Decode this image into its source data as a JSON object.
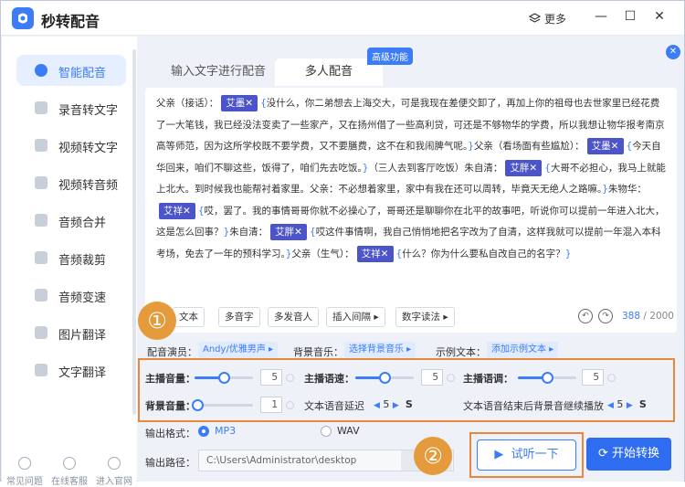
{
  "app": {
    "title": "秒转配音",
    "more_label": "更多"
  },
  "sidebar": {
    "items": [
      {
        "label": "智能配音",
        "active": true
      },
      {
        "label": "录音转文字"
      },
      {
        "label": "视频转文字"
      },
      {
        "label": "视频转音频"
      },
      {
        "label": "音频合并"
      },
      {
        "label": "音频裁剪"
      },
      {
        "label": "音频变速"
      },
      {
        "label": "图片翻译"
      },
      {
        "label": "文字翻译"
      }
    ],
    "bottom": [
      {
        "label": "常见问题"
      },
      {
        "label": "在线客服"
      },
      {
        "label": "进入官网"
      }
    ]
  },
  "tabs": [
    {
      "label": "输入文字进行配音"
    },
    {
      "label": "多人配音",
      "active": true
    }
  ],
  "badge": "高级功能",
  "editor": {
    "segments": [
      {
        "t": "text",
        "v": "父亲（接话）："
      },
      {
        "t": "tag",
        "v": "艾墨✕"
      },
      {
        "t": "brace",
        "v": "{"
      },
      {
        "t": "text",
        "v": "没什么，你二弟想去上海交大，可是我现在差便交卸了，再加上你的祖母也去世家里已经花费了一大笔钱，我已经没法变卖了一些家产，又在扬州借了一些高利贷，可还是不够物华的学费，所以我想让物华报考南京高等师范，因为这所学校既不要学费，又不要膳费，这不在和我闹脾气呢。"
      },
      {
        "t": "brace",
        "v": "}"
      },
      {
        "t": "text",
        "v": "父亲（看场面有些尴尬）："
      },
      {
        "t": "tag",
        "v": "艾墨✕"
      },
      {
        "t": "brace",
        "v": "{"
      },
      {
        "t": "text",
        "v": "今天自华回来，咱们不聊这些，饭得了，咱们先去吃饭。"
      },
      {
        "t": "brace",
        "v": "}"
      },
      {
        "t": "text",
        "v": "（三人去到客厅吃饭）朱自清："
      },
      {
        "t": "tag",
        "v": "艾胖✕"
      },
      {
        "t": "brace",
        "v": "{"
      },
      {
        "t": "text",
        "v": "大哥不必担心，我马上就能上北大。到时候我也能帮衬着家里。父亲：不必想着家里，家中有我在还可以周转，毕竟天无绝人之路嘛。"
      },
      {
        "t": "brace",
        "v": "}"
      },
      {
        "t": "text",
        "v": "朱物华："
      },
      {
        "t": "tag",
        "v": "艾祥✕"
      },
      {
        "t": "brace",
        "v": "{"
      },
      {
        "t": "text",
        "v": "哎，罢了。我的事情哥哥你就不必操心了，哥哥还是聊聊你在北平的故事吧，听说你可以提前一年进入北大，这是怎么回事？"
      },
      {
        "t": "brace",
        "v": "}"
      },
      {
        "t": "text",
        "v": "朱自清："
      },
      {
        "t": "tag",
        "v": "艾胖✕"
      },
      {
        "t": "brace",
        "v": "{"
      },
      {
        "t": "text",
        "v": "哎这件事情啊，我自己悄悄地把名字改为了自清，这样我就可以提前一年混入本科考场，免去了一年的预科学习。"
      },
      {
        "t": "brace",
        "v": "}"
      },
      {
        "t": "text",
        "v": "父亲（生气）："
      },
      {
        "t": "tag",
        "v": "艾祥✕"
      },
      {
        "t": "brace",
        "v": "{"
      },
      {
        "t": "text",
        "v": "什么？你为什么要私自改自己的名字？"
      },
      {
        "t": "brace",
        "v": "}"
      }
    ],
    "tools": [
      "文本",
      "多音字",
      "多发音人",
      "插入间隔 ▸",
      "数字读法 ▸"
    ],
    "count_current": "388",
    "count_total": "/ 2000"
  },
  "annotations": {
    "one": "①",
    "two": "②"
  },
  "settings": {
    "voice_label": "配音演员：",
    "voice_value": "Andy/优雅男声 ▸",
    "music_label": "背景音乐：",
    "music_value": "选择背景音乐 ▸",
    "example_label": "示例文本：",
    "example_value": "添加示例文本 ▸"
  },
  "params": {
    "host_volume": {
      "label": "主播音量：",
      "value": "5",
      "level": 0.5
    },
    "host_speed": {
      "label": "主播语速：",
      "value": "5",
      "level": 0.5
    },
    "host_pitch": {
      "label": "主播语调：",
      "value": "5",
      "level": 0.5
    },
    "bg_volume": {
      "label": "背景音量：",
      "value": "1",
      "level": 0.05
    },
    "delay": {
      "label": "文本语音延迟",
      "value": "5",
      "unit": "S"
    },
    "after_end": {
      "label": "文本语音结束后背景音继续播放",
      "value": "5",
      "unit": "S"
    }
  },
  "output": {
    "format_label": "输出格式：",
    "formats": [
      {
        "label": "MP3",
        "selected": true
      },
      {
        "label": "WAV",
        "selected": false
      }
    ],
    "path_label": "输出路径：",
    "path_value": "C:\\Users\\Administrator\\desktop"
  },
  "buttons": {
    "listen": "试听一下",
    "convert": "开始转换"
  },
  "colors": {
    "accent": "#3c7cf6",
    "annotation": "#e9873a",
    "tag": "#4b54c8"
  }
}
